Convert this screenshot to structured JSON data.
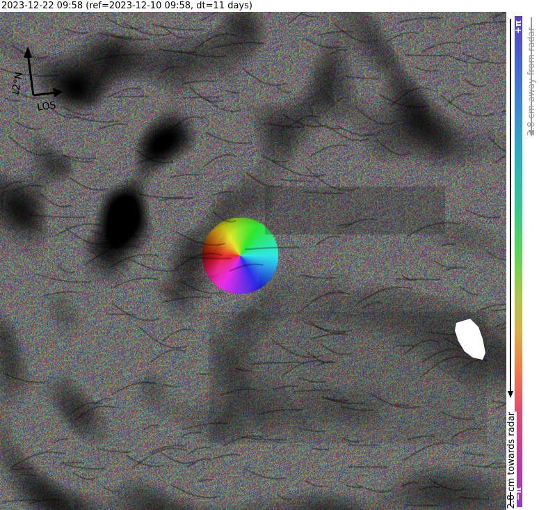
{
  "header": {
    "title": "2023-12-22 09:58 (ref=2023-12-10 09:58, dt=11 days)"
  },
  "compass": {
    "north_label": "12°N",
    "los_label": "LOS"
  },
  "legend": {
    "top_label": "+π",
    "bottom_label": "−π",
    "away_text": "2.8 cm away from radar",
    "towards_text": "2.8 cm towards radar",
    "colors": {
      "top": "#5c3fbf",
      "bottom": "#8b3fbf",
      "away_arrow": "#9a9a9a",
      "towards_arrow": "#000000"
    }
  },
  "map": {
    "type": "interferogram-phase",
    "has_masked_area": true
  }
}
